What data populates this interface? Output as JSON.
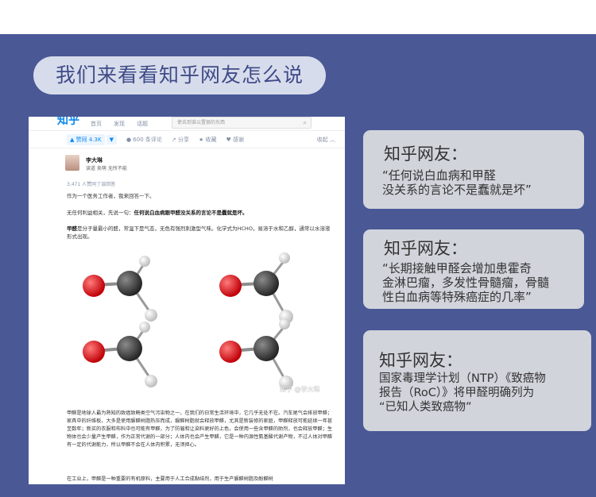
{
  "headline": "我们来看看知乎网友怎么说",
  "zhihu": {
    "logo": "知乎",
    "nav": [
      "首页",
      "发现",
      "话题"
    ],
    "search_placeholder": "使去到谁以置很的东西",
    "vote_up_label": "▲ 赞同 4.3K",
    "vote_down_label": "▼",
    "comments": "600 条评论",
    "share": "分享",
    "favorite": "收藏",
    "thanks": "感谢",
    "fold": "收起 ︿",
    "author_name": "李大琳",
    "author_bio": "读道 卖萌 无所不能",
    "agree_count": "3,471 人赞同了该回答",
    "para1": "作为一个医务工作者，我来回答一下。",
    "para2_prefix": "无任何利益相关，先说一句：",
    "para2_bold": "任何说白血病跟甲醛没关系的言论不是蠢就是坏。",
    "para3_bold": "甲醛",
    "para3_rest": "是分子量最小的醛，常温下是气态，无色有强烈刺激型气味。化学式为HCHO，易溶于水和乙醇，通常以水溶液形式出现。",
    "watermark": "知乎 @李大琳",
    "para4": "甲醛是地球人最为熟知的致癌致畸类空气污染物之一，在我们的日常生活环境中，它几乎无处不在。汽车尾气会排放甲醛；家具中的纤维板，大多是使用脲醛树脂热压而成，脲醛树脂就会释放甲醛，尤其是新装修的家庭，甲醛释放可能延续一年甚至数年；新买的衣服和布料中也可能有甲醛，为了防皱和让染料更好的上色，会使用一些含甲醛的助剂，也会释放甲醛；生物体也会少量产生甲醛，作为正常代谢的一部分；人体内也会产生甲醛，它是一种内源性氨基酸代谢产物，不过人体对甲醛有一定的代谢能力，所以甲醛不会在人体内积累，无须担心。",
    "para5": "在工业上，甲醛是一种重要的有机原料，主要用于人工合成黏结剂，用于生产脲醛树脂及酚醛树"
  },
  "cards": [
    {
      "title": "知乎网友：",
      "quote": "“任何说白血病和甲醛\n没关系的言论不是蠢就是坏”"
    },
    {
      "title": "知乎网友：",
      "quote": "“长期接触甲醛会增加患霍奇\n金淋巴瘤，多发性骨髓瘤，骨髓\n性白血病等特殊癌症的几率”"
    },
    {
      "title": "知乎网友：",
      "quote": "国家毒理学计划（NTP）《致癌物\n报告（RoC）》将甲醛明确列为\n“已知人类致癌物”"
    }
  ],
  "colors": {
    "band": "#4a5896",
    "pill": "#d7dcec",
    "card": "#d2d4dc",
    "oxygen": "#e8141c",
    "carbon": "#444444",
    "hydrogen": "#f2f2f2"
  },
  "icons": [
    "search-icon",
    "comment-icon",
    "share-icon",
    "star-icon",
    "heart-icon"
  ]
}
